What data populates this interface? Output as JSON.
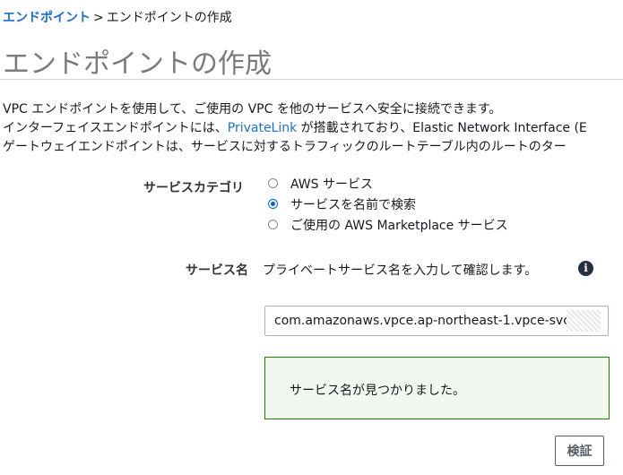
{
  "breadcrumb": {
    "root": "エンドポイント",
    "separator": ">",
    "current": "エンドポイントの作成"
  },
  "page_title": "エンドポイントの作成",
  "description": {
    "line1": "VPC エンドポイントを使用して、ご使用の VPC を他のサービスへ安全に接続できます。",
    "line2_before": "インターフェイスエンドポイントには、",
    "line2_link": "PrivateLink",
    "line2_after": " が搭載されており、Elastic Network Interface (E",
    "line3": "ゲートウェイエンドポイントは、サービスに対するトラフィックのルートテーブル内のルートのター"
  },
  "service_category": {
    "label": "サービスカテゴリ",
    "options": [
      {
        "label": "AWS サービス",
        "selected": false
      },
      {
        "label": "サービスを名前で検索",
        "selected": true
      },
      {
        "label": "ご使用の AWS Marketplace サービス",
        "selected": false
      }
    ]
  },
  "service_name": {
    "label": "サービス名",
    "hint": "プライベートサービス名を入力して確認します。",
    "info_icon": "info-circle-icon",
    "value": "com.amazonaws.vpce.ap-northeast-1.vpce-svc-"
  },
  "success_message": "サービス名が見つかりました。",
  "verify_button": "検証",
  "colors": {
    "link": "#1a6ed8",
    "success_border": "#1d8102",
    "success_bg": "#f2f8f0",
    "radio_selected": "#0066cc"
  }
}
